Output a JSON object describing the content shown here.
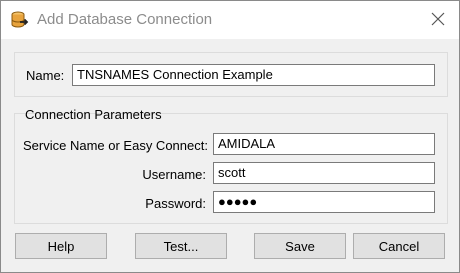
{
  "window": {
    "title": "Add Database Connection",
    "icon": "database-connection-icon",
    "close_icon": "close-icon"
  },
  "name_field": {
    "label": "Name:",
    "value": "TNSNAMES Connection Example"
  },
  "connection_parameters": {
    "group_title": "Connection Parameters",
    "service_name": {
      "label": "Service Name or Easy Connect:",
      "value": "AMIDALA"
    },
    "username": {
      "label": "Username:",
      "value": "scott"
    },
    "password": {
      "label": "Password:",
      "masked_value": "●●●●●"
    }
  },
  "buttons": {
    "help": "Help",
    "test": "Test...",
    "save": "Save",
    "cancel": "Cancel"
  },
  "colors": {
    "title_text": "#8c8c8c",
    "dialog_background": "#f0f0f0",
    "icon_orange": "#e8a33d"
  }
}
